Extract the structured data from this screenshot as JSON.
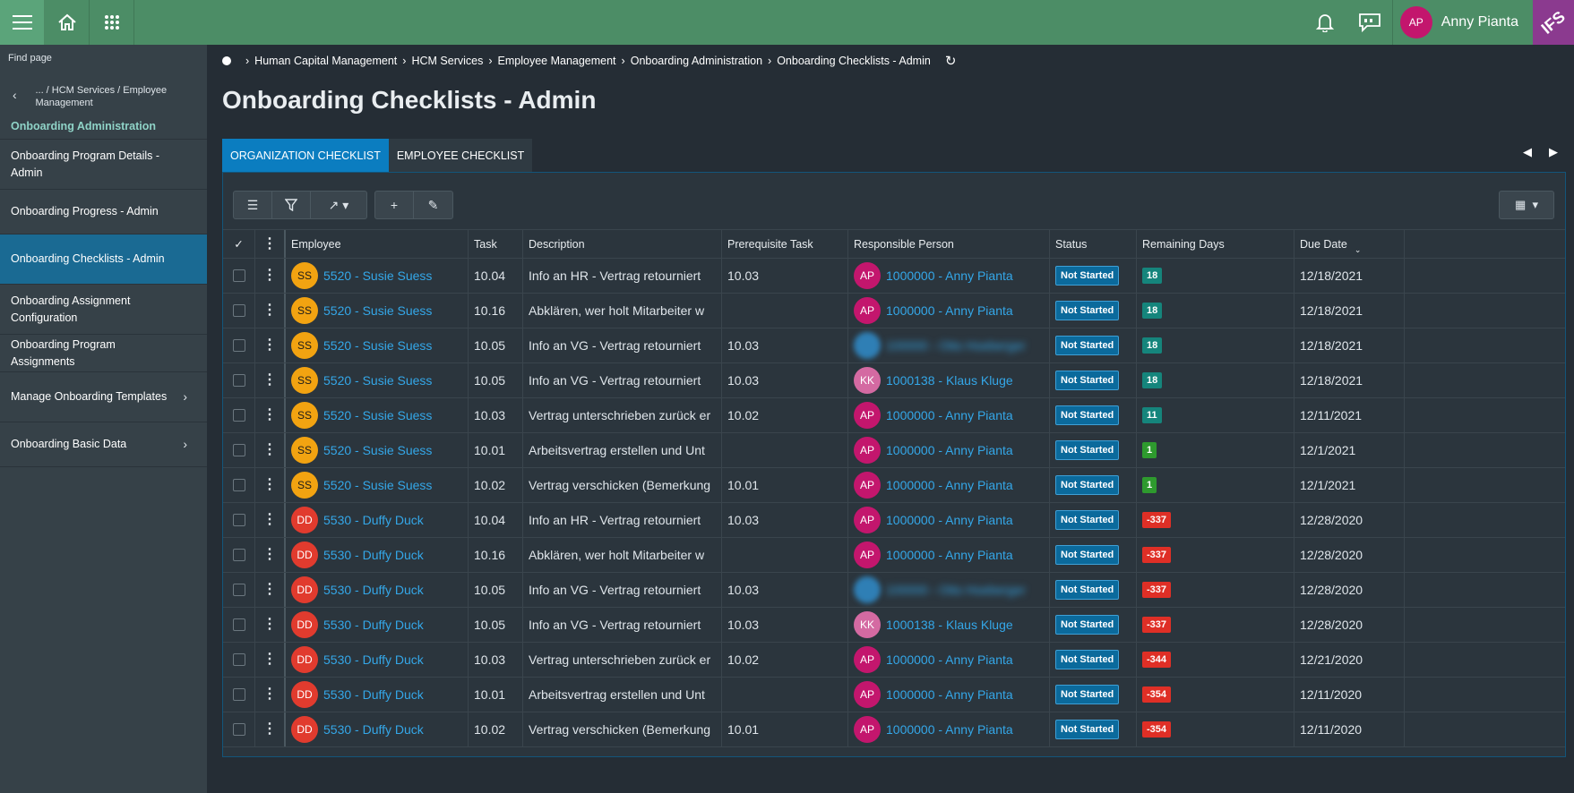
{
  "topbar": {
    "user_initials": "AP",
    "user_name": "Anny Pianta",
    "logo_text": "IFS",
    "icons": [
      "menu-icon",
      "home-icon",
      "apps-grid-icon",
      "bell-icon",
      "feedback-icon"
    ]
  },
  "sidebar": {
    "find_page": "Find page",
    "back_path": "... / HCM Services / Employee Management",
    "section_title": "Onboarding Administration",
    "items": [
      {
        "label": "Onboarding Program Details - Admin",
        "active": false,
        "chevron": false
      },
      {
        "label": "Onboarding Progress - Admin",
        "active": false,
        "chevron": false
      },
      {
        "label": "Onboarding Checklists - Admin",
        "active": true,
        "chevron": false
      },
      {
        "label": "Onboarding Assignment Configuration",
        "active": false,
        "chevron": false
      },
      {
        "label": "Onboarding Program Assignments",
        "active": false,
        "chevron": false
      },
      {
        "label": "Manage Onboarding Templates",
        "active": false,
        "chevron": true
      },
      {
        "label": "Onboarding Basic Data",
        "active": false,
        "chevron": true
      }
    ]
  },
  "breadcrumb": [
    "Human Capital Management",
    "HCM Services",
    "Employee Management",
    "Onboarding Administration",
    "Onboarding Checklists - Admin"
  ],
  "page_title": "Onboarding Checklists - Admin",
  "tabs": [
    {
      "label": "ORGANIZATION CHECKLIST",
      "active": true
    },
    {
      "label": "EMPLOYEE CHECKLIST",
      "active": false
    }
  ],
  "table": {
    "columns": [
      "Employee",
      "Task",
      "Description",
      "Prerequisite Task",
      "Responsible Person",
      "Status",
      "Remaining Days",
      "Due Date"
    ],
    "rows": [
      {
        "emp_initials": "SS",
        "emp": "5520 - Susie Suess",
        "task": "10.04",
        "desc": "Info an HR - Vertrag retourniert",
        "pre": "10.03",
        "resp_initials": "AP",
        "resp": "1000000 - Anny Pianta",
        "status": "Not Started",
        "days": "18",
        "days_color": "teal",
        "due": "12/18/2021"
      },
      {
        "emp_initials": "SS",
        "emp": "5520 - Susie Suess",
        "task": "10.16",
        "desc": "Abklären, wer holt Mitarbeiter w",
        "pre": "",
        "resp_initials": "AP",
        "resp": "1000000 - Anny Pianta",
        "status": "Not Started",
        "days": "18",
        "days_color": "teal",
        "due": "12/18/2021"
      },
      {
        "emp_initials": "SS",
        "emp": "5520 - Susie Suess",
        "task": "10.05",
        "desc": "Info an VG - Vertrag retourniert",
        "pre": "10.03",
        "resp_initials": "",
        "resp": "100000 - Otto Hoeberger",
        "resp_blurred": true,
        "status": "Not Started",
        "days": "18",
        "days_color": "teal",
        "due": "12/18/2021"
      },
      {
        "emp_initials": "SS",
        "emp": "5520 - Susie Suess",
        "task": "10.05",
        "desc": "Info an VG - Vertrag retourniert",
        "pre": "10.03",
        "resp_initials": "KK",
        "resp": "1000138 - Klaus Kluge",
        "status": "Not Started",
        "days": "18",
        "days_color": "teal",
        "due": "12/18/2021"
      },
      {
        "emp_initials": "SS",
        "emp": "5520 - Susie Suess",
        "task": "10.03",
        "desc": "Vertrag unterschrieben zurück er",
        "pre": "10.02",
        "resp_initials": "AP",
        "resp": "1000000 - Anny Pianta",
        "status": "Not Started",
        "days": "11",
        "days_color": "teal",
        "due": "12/11/2021"
      },
      {
        "emp_initials": "SS",
        "emp": "5520 - Susie Suess",
        "task": "10.01",
        "desc": "Arbeitsvertrag erstellen und Unt",
        "pre": "",
        "resp_initials": "AP",
        "resp": "1000000 - Anny Pianta",
        "status": "Not Started",
        "days": "1",
        "days_color": "green",
        "due": "12/1/2021"
      },
      {
        "emp_initials": "SS",
        "emp": "5520 - Susie Suess",
        "task": "10.02",
        "desc": "Vertrag verschicken (Bemerkung",
        "pre": "10.01",
        "resp_initials": "AP",
        "resp": "1000000 - Anny Pianta",
        "status": "Not Started",
        "days": "1",
        "days_color": "green",
        "due": "12/1/2021"
      },
      {
        "emp_initials": "DD",
        "emp": "5530 - Duffy Duck",
        "task": "10.04",
        "desc": "Info an HR - Vertrag retourniert",
        "pre": "10.03",
        "resp_initials": "AP",
        "resp": "1000000 - Anny Pianta",
        "status": "Not Started",
        "days": "-337",
        "days_color": "red",
        "due": "12/28/2020"
      },
      {
        "emp_initials": "DD",
        "emp": "5530 - Duffy Duck",
        "task": "10.16",
        "desc": "Abklären, wer holt Mitarbeiter w",
        "pre": "",
        "resp_initials": "AP",
        "resp": "1000000 - Anny Pianta",
        "status": "Not Started",
        "days": "-337",
        "days_color": "red",
        "due": "12/28/2020"
      },
      {
        "emp_initials": "DD",
        "emp": "5530 - Duffy Duck",
        "task": "10.05",
        "desc": "Info an VG - Vertrag retourniert",
        "pre": "10.03",
        "resp_initials": "",
        "resp": "100000 - Otto Hoeberger",
        "resp_blurred": true,
        "status": "Not Started",
        "days": "-337",
        "days_color": "red",
        "due": "12/28/2020"
      },
      {
        "emp_initials": "DD",
        "emp": "5530 - Duffy Duck",
        "task": "10.05",
        "desc": "Info an VG - Vertrag retourniert",
        "pre": "10.03",
        "resp_initials": "KK",
        "resp": "1000138 - Klaus Kluge",
        "status": "Not Started",
        "days": "-337",
        "days_color": "red",
        "due": "12/28/2020"
      },
      {
        "emp_initials": "DD",
        "emp": "5530 - Duffy Duck",
        "task": "10.03",
        "desc": "Vertrag unterschrieben zurück er",
        "pre": "10.02",
        "resp_initials": "AP",
        "resp": "1000000 - Anny Pianta",
        "status": "Not Started",
        "days": "-344",
        "days_color": "red",
        "due": "12/21/2020"
      },
      {
        "emp_initials": "DD",
        "emp": "5530 - Duffy Duck",
        "task": "10.01",
        "desc": "Arbeitsvertrag erstellen und Unt",
        "pre": "",
        "resp_initials": "AP",
        "resp": "1000000 - Anny Pianta",
        "status": "Not Started",
        "days": "-354",
        "days_color": "red",
        "due": "12/11/2020"
      },
      {
        "emp_initials": "DD",
        "emp": "5530 - Duffy Duck",
        "task": "10.02",
        "desc": "Vertrag verschicken (Bemerkung",
        "pre": "10.01",
        "resp_initials": "AP",
        "resp": "1000000 - Anny Pianta",
        "status": "Not Started",
        "days": "-354",
        "days_color": "red",
        "due": "12/11/2020"
      }
    ]
  },
  "colors": {
    "topbar": "#4c8d66",
    "sidebar": "#364148",
    "active_nav": "#1a6a93",
    "link": "#34a7e8",
    "accent_tab": "#0b7dc0"
  }
}
